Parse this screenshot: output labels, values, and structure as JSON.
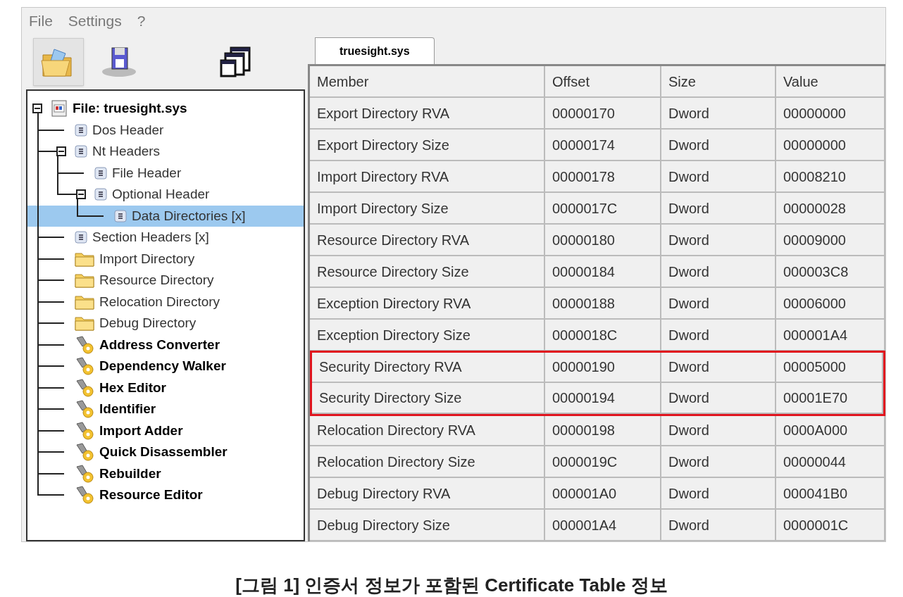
{
  "menu": [
    "File",
    "Settings",
    "?"
  ],
  "toolbar": [
    {
      "kind": "open",
      "selected": true
    },
    {
      "kind": "save",
      "selected": false
    },
    {
      "kind": "windows",
      "selected": false
    }
  ],
  "tree": [
    {
      "label": "File: truesight.sys",
      "kind": "root",
      "expanded": true,
      "selected": false,
      "children": [
        {
          "label": "Dos Header",
          "kind": "header",
          "selected": false
        },
        {
          "label": "Nt Headers",
          "kind": "header",
          "expanded": true,
          "selected": false,
          "children": [
            {
              "label": "File Header",
              "kind": "header",
              "selected": false
            },
            {
              "label": "Optional Header",
              "kind": "header",
              "expanded": true,
              "selected": false,
              "children": [
                {
                  "label": "Data Directories [x]",
                  "kind": "header",
                  "selected": true
                }
              ]
            }
          ]
        },
        {
          "label": "Section Headers [x]",
          "kind": "header",
          "selected": false
        },
        {
          "label": "Import Directory",
          "kind": "folder",
          "selected": false
        },
        {
          "label": "Resource Directory",
          "kind": "folder",
          "selected": false
        },
        {
          "label": "Relocation Directory",
          "kind": "folder",
          "selected": false
        },
        {
          "label": "Debug Directory",
          "kind": "folder",
          "selected": false
        },
        {
          "label": "Address Converter",
          "kind": "tool",
          "selected": false
        },
        {
          "label": "Dependency Walker",
          "kind": "tool",
          "selected": false
        },
        {
          "label": "Hex Editor",
          "kind": "tool",
          "selected": false
        },
        {
          "label": "Identifier",
          "kind": "tool",
          "selected": false
        },
        {
          "label": "Import Adder",
          "kind": "tool",
          "selected": false
        },
        {
          "label": "Quick Disassembler",
          "kind": "tool",
          "selected": false
        },
        {
          "label": "Rebuilder",
          "kind": "tool",
          "selected": false
        },
        {
          "label": "Resource Editor",
          "kind": "tool",
          "selected": false
        }
      ]
    }
  ],
  "tabs": [
    {
      "label": "truesight.sys",
      "selected": true
    }
  ],
  "table": {
    "columns": [
      "Member",
      "Offset",
      "Size",
      "Value"
    ],
    "rows": [
      {
        "cells": [
          "Export Directory RVA",
          "00000170",
          "Dword",
          "00000000"
        ],
        "highlighted": false
      },
      {
        "cells": [
          "Export Directory Size",
          "00000174",
          "Dword",
          "00000000"
        ],
        "highlighted": false
      },
      {
        "cells": [
          "Import Directory RVA",
          "00000178",
          "Dword",
          "00008210"
        ],
        "highlighted": false
      },
      {
        "cells": [
          "Import Directory Size",
          "0000017C",
          "Dword",
          "00000028"
        ],
        "highlighted": false
      },
      {
        "cells": [
          "Resource Directory RVA",
          "00000180",
          "Dword",
          "00009000"
        ],
        "highlighted": false
      },
      {
        "cells": [
          "Resource Directory Size",
          "00000184",
          "Dword",
          "000003C8"
        ],
        "highlighted": false
      },
      {
        "cells": [
          "Exception Directory RVA",
          "00000188",
          "Dword",
          "00006000"
        ],
        "highlighted": false
      },
      {
        "cells": [
          "Exception Directory Size",
          "0000018C",
          "Dword",
          "000001A4"
        ],
        "highlighted": false
      },
      {
        "cells": [
          "Security Directory RVA",
          "00000190",
          "Dword",
          "00005000"
        ],
        "highlighted": true
      },
      {
        "cells": [
          "Security Directory Size",
          "00000194",
          "Dword",
          "00001E70"
        ],
        "highlighted": true
      },
      {
        "cells": [
          "Relocation Directory RVA",
          "00000198",
          "Dword",
          "0000A000"
        ],
        "highlighted": false
      },
      {
        "cells": [
          "Relocation Directory Size",
          "0000019C",
          "Dword",
          "00000044"
        ],
        "highlighted": false
      },
      {
        "cells": [
          "Debug Directory RVA",
          "000001A0",
          "Dword",
          "000041B0"
        ],
        "highlighted": false
      },
      {
        "cells": [
          "Debug Directory Size",
          "000001A4",
          "Dword",
          "0000001C"
        ],
        "highlighted": false
      }
    ]
  },
  "caption": "[그림 1] 인증서 정보가 포함된 Certificate Table 정보"
}
